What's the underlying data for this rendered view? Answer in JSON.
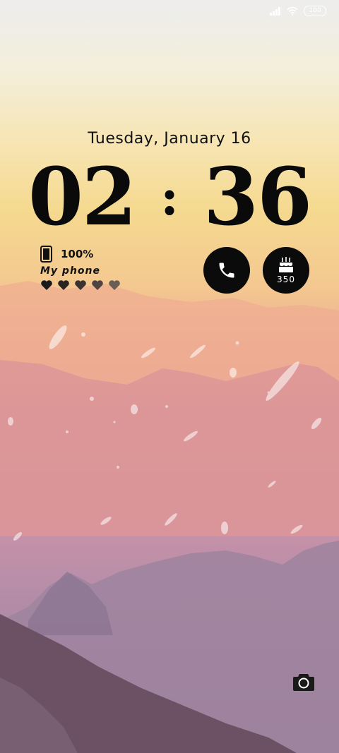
{
  "status_bar": {
    "battery_level": "100",
    "icons": [
      "signal-icon",
      "wifi-icon",
      "battery-icon"
    ]
  },
  "lockscreen": {
    "date": "Tuesday, January 16",
    "time": {
      "hours": "02",
      "separator": ":",
      "minutes": "36"
    }
  },
  "phone_widget": {
    "device_icon": "phone-device-icon",
    "battery_percent": "100%",
    "device_name": "My phone",
    "hearts_total": 5
  },
  "shortcuts": {
    "phone": {
      "icon": "phone-icon"
    },
    "birthday": {
      "icon": "cake-icon",
      "count": "350"
    }
  },
  "camera": {
    "icon": "camera-icon"
  },
  "colors": {
    "sky_top": "#ededed",
    "sky_glow": "#f5d98f",
    "mountain_pink": "#e39a99",
    "mountain_purple": "#a887a5",
    "foreground_hill": "#6c5064",
    "text_dark": "#111111",
    "button_bg": "#0b0b0b"
  }
}
